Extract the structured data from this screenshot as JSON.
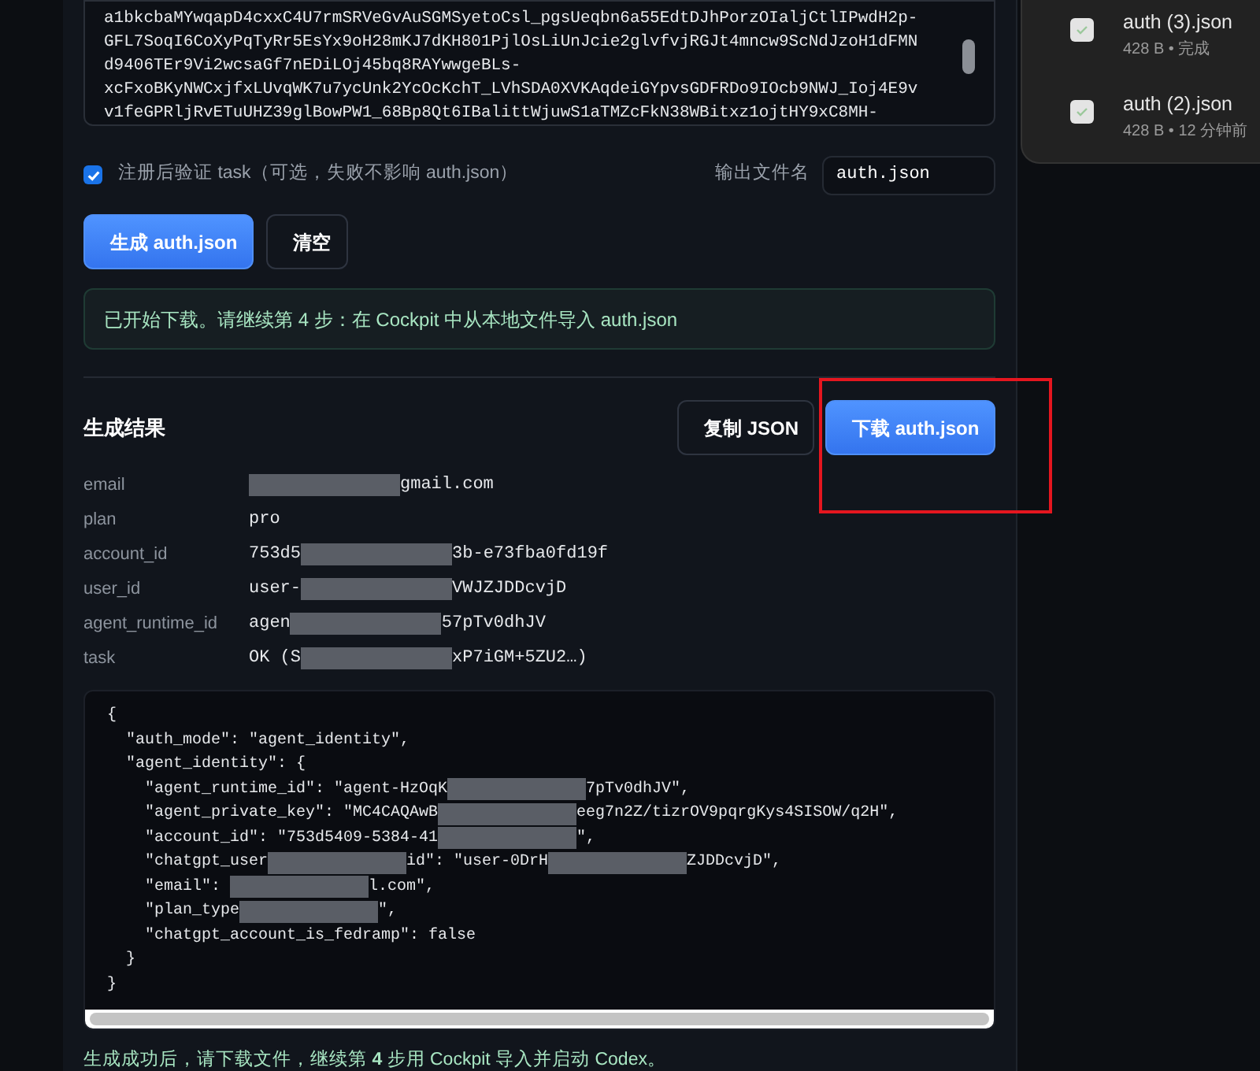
{
  "token_text": [
    "a1bkcbaMYwqapD4cxxC4U7rmSRVeGvAuSGMSyetoCsl_pgsUeqbn6a55EdtDJhPorzOIaljCtlIPwdH2p-",
    "GFL7SoqI6CoXyPqTyRr5EsYx9oH28mKJ7dKH801PjlOsLiUnJcie2glvfvjRGJt4mncw9ScNdJzoH1dFMN",
    "d9406TEr9Vi2wcsaGf7nEDiLOj45bq8RAYwwgeBLs-",
    "xcFxoBKyNWCxjfxLUvqWK7u7ycUnk2YcOcKchT_LVhSDA0XVKAqdeiGYpvsGDFRDo9IOcb9NWJ_Ioj4E9v",
    "v1feGPRljRvETuUHZ39glBowPW1_68Bp8Qt6IBalittWjuwS1aTMZcFkN38WBitxz1ojtHY9xC8MH-"
  ],
  "verify": {
    "label": "注册后验证 task（可选，失败不影响 auth.json）",
    "checked": true
  },
  "output": {
    "label": "输出文件名",
    "value": "auth.json"
  },
  "buttons": [
    {
      "label": "生成 auth.json",
      "kind": "primary"
    },
    {
      "label": "清空",
      "kind": "secondary"
    }
  ],
  "notice": "已开始下载。请继续第 4 步：在 Cockpit 中从本地文件导入 auth.json",
  "result": {
    "title": "生成结果",
    "actions": [
      {
        "label": "复制 JSON",
        "kind": "secondary",
        "highlighted": false
      },
      {
        "label": "下载 auth.json",
        "kind": "primary",
        "highlighted": true
      }
    ],
    "fields": [
      {
        "key": "email",
        "lead_redacted": true,
        "parts": [
          "gmail.com"
        ]
      },
      {
        "key": "plan",
        "parts": [
          "pro"
        ]
      },
      {
        "key": "account_id",
        "parts": [
          "753d5",
          "3b-e73fba0fd19f"
        ]
      },
      {
        "key": "user_id",
        "parts": [
          "user-",
          "VWJZJDDcvjD"
        ]
      },
      {
        "key": "agent_runtime_id",
        "parts": [
          "agen",
          "57pTv0dhJV"
        ]
      },
      {
        "key": "task",
        "parts": [
          "OK (S",
          "xP7iGM+5ZU2…)"
        ]
      }
    ],
    "code_lines": [
      {
        "parts": [
          "{"
        ]
      },
      {
        "parts": [
          "  \"auth_mode\": \"agent_identity\","
        ]
      },
      {
        "parts": [
          "  \"agent_identity\": {"
        ]
      },
      {
        "parts": [
          "    \"agent_runtime_id\": \"agent-HzOqK",
          "7pTv0dhJV\","
        ]
      },
      {
        "parts": [
          "    \"agent_private_key\": \"MC4CAQAwB",
          "eeg7n2Z/tizrOV9pqrgKys4SISOW/q2H\","
        ]
      },
      {
        "parts": [
          "    \"account_id\": \"753d5409-5384-41",
          "\","
        ]
      },
      {
        "parts": [
          "    \"chatgpt_user",
          "id\": \"user-0DrH",
          "ZJDDcvjD\","
        ]
      },
      {
        "parts": [
          "    \"email\": ",
          "l.com\","
        ]
      },
      {
        "parts": [
          "    \"plan_type",
          "\","
        ]
      },
      {
        "parts": [
          "    \"chatgpt_account_is_fedramp\": false"
        ]
      },
      {
        "parts": [
          "  }"
        ]
      },
      {
        "parts": [
          "}"
        ]
      }
    ],
    "hint": "生成成功后，请下载文件，继续第 **4** 步用 Cockpit 导入并启动 Codex。"
  },
  "downloads": [
    {
      "name": "auth (3).json",
      "meta": "428 B • 完成"
    },
    {
      "name": "auth (2).json",
      "meta": "428 B • 12 分钟前"
    }
  ]
}
